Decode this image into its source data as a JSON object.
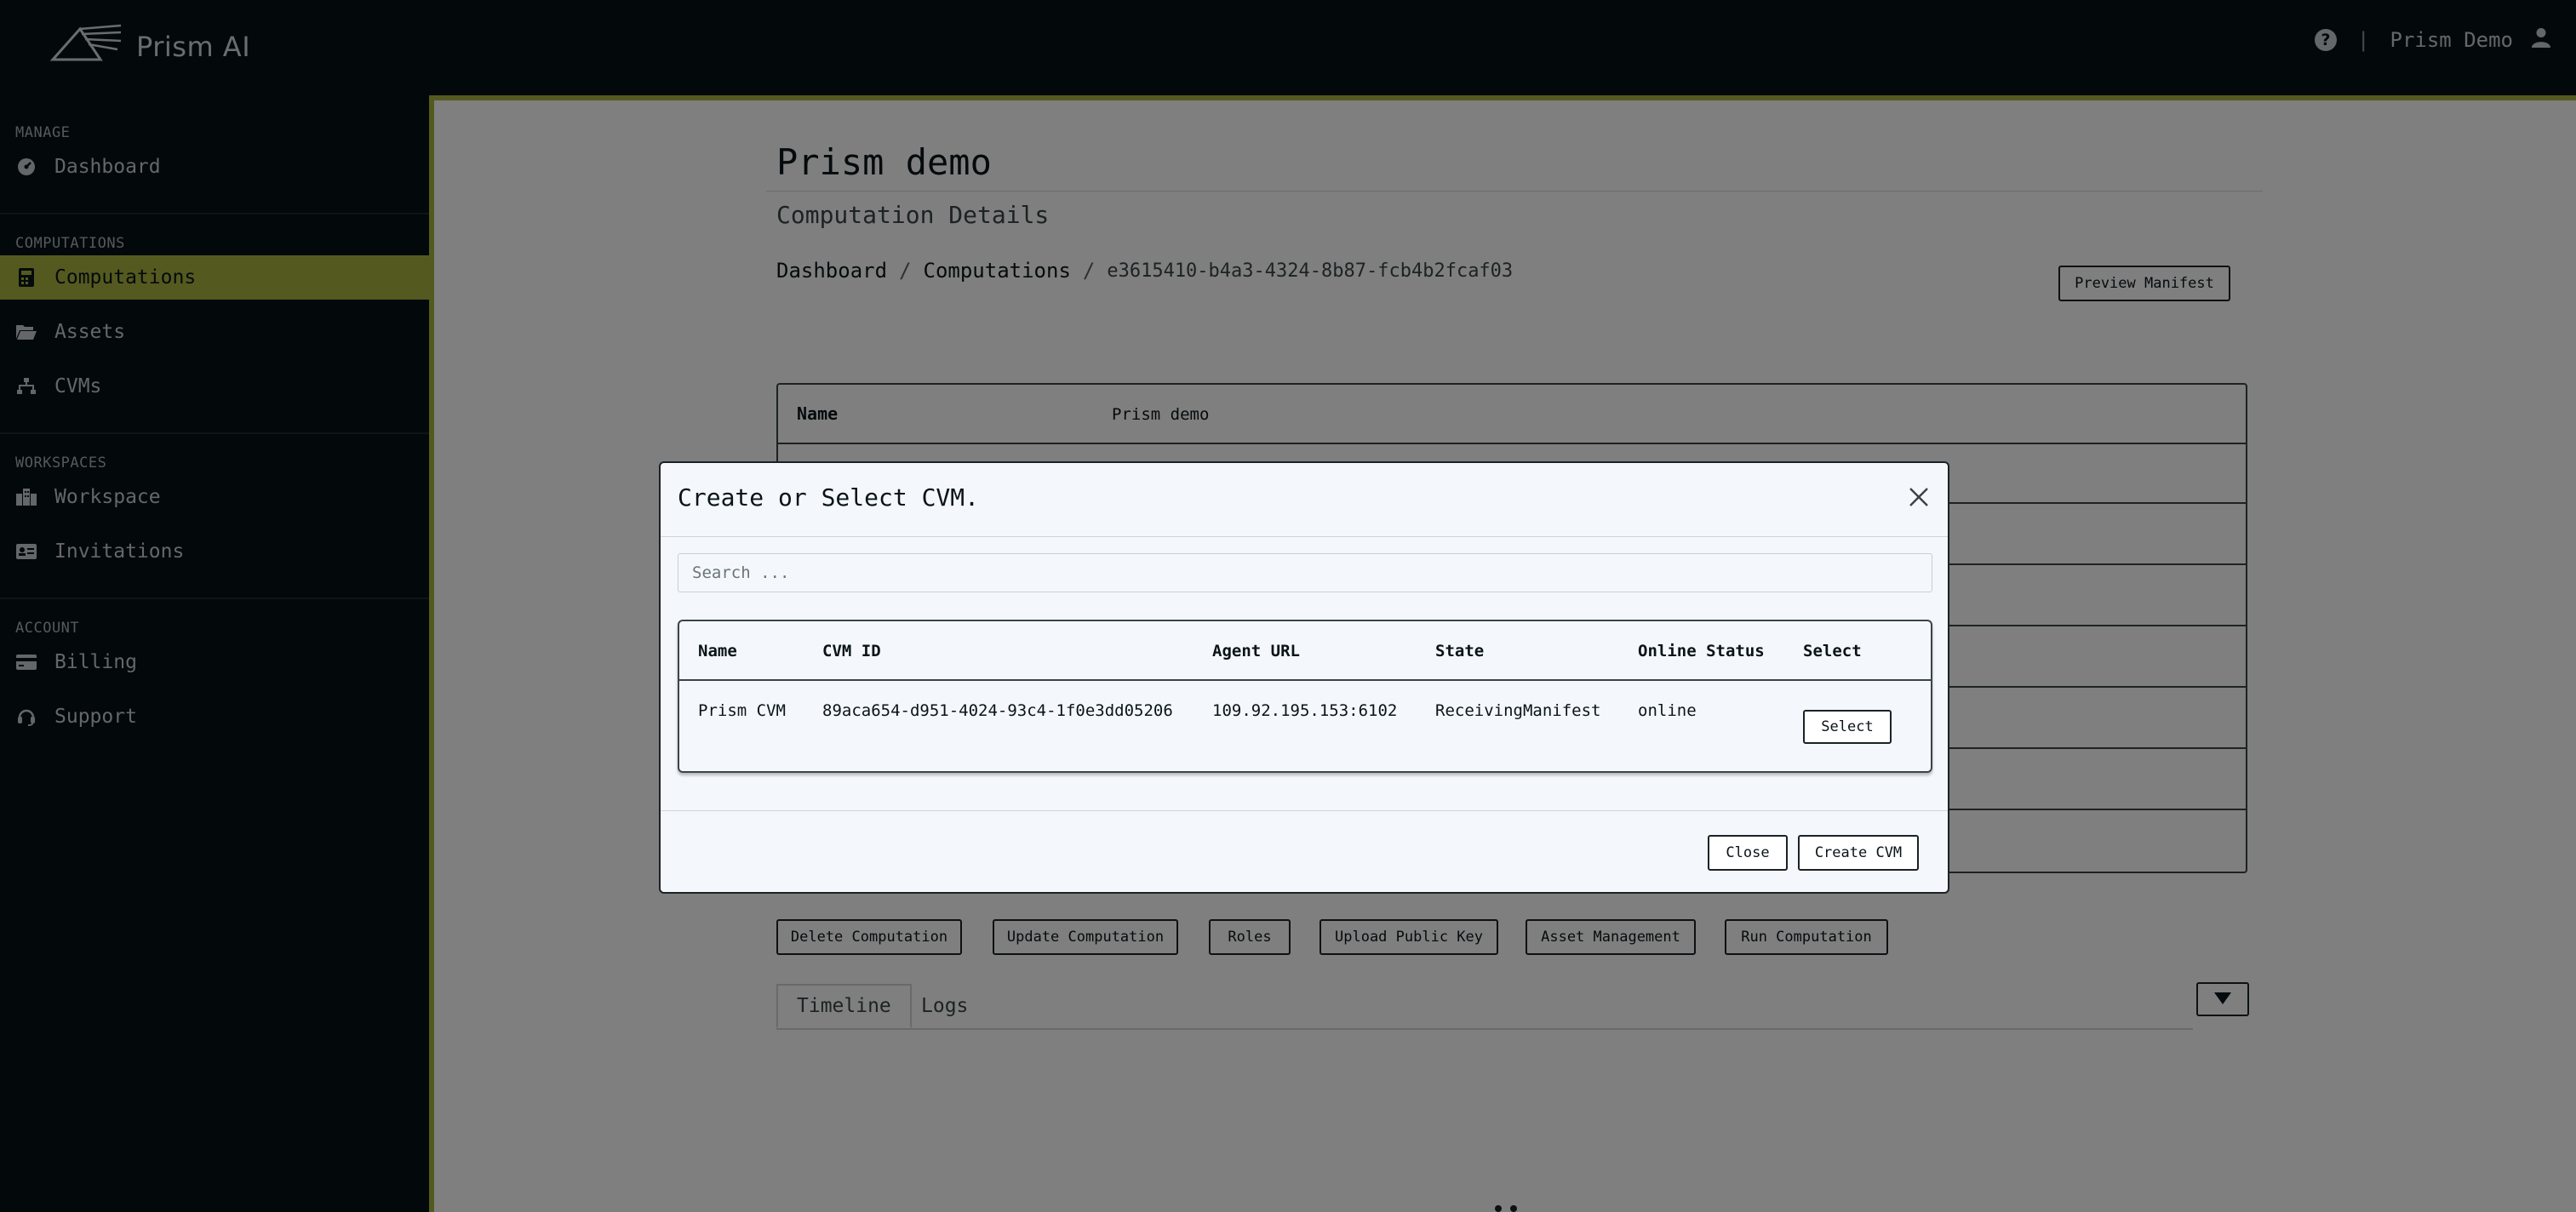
{
  "app": {
    "brand": "Prism AI",
    "user_name": "Prism Demo",
    "help_glyph": "?",
    "separator": "|"
  },
  "sidebar": {
    "sections": [
      {
        "label": "MANAGE",
        "items": [
          {
            "label": "Dashboard",
            "icon": "gauge-icon"
          }
        ]
      },
      {
        "label": "COMPUTATIONS",
        "items": [
          {
            "label": "Computations",
            "icon": "calculator-icon",
            "active": true
          },
          {
            "label": "Assets",
            "icon": "folder-open-icon"
          },
          {
            "label": "CVMs",
            "icon": "sitemap-icon"
          }
        ]
      },
      {
        "label": "WORKSPACES",
        "items": [
          {
            "label": "Workspace",
            "icon": "building-icon"
          },
          {
            "label": "Invitations",
            "icon": "id-card-icon"
          }
        ]
      },
      {
        "label": "ACCOUNT",
        "items": [
          {
            "label": "Billing",
            "icon": "credit-card-icon"
          },
          {
            "label": "Support",
            "icon": "headset-icon"
          }
        ]
      }
    ]
  },
  "main": {
    "title": "Prism demo",
    "subtitle": "Computation Details",
    "breadcrumb": {
      "dashboard": "Dashboard",
      "computations": "Computations",
      "current": "e3615410-b4a3-4324-8b87-fcb4b2fcaf03",
      "separator": "/"
    },
    "preview_manifest_label": "Preview Manifest",
    "details": {
      "name_label": "Name",
      "name_value": "Prism demo"
    },
    "actions": {
      "delete": "Delete Computation",
      "update": "Update Computation",
      "roles": "Roles",
      "upload_key": "Upload Public Key",
      "asset_management": "Asset Management",
      "run": "Run Computation"
    },
    "tabs": {
      "timeline": "Timeline",
      "logs": "Logs"
    }
  },
  "modal": {
    "title": "Create or Select CVM.",
    "search_placeholder": "Search ...",
    "table": {
      "headers": {
        "name": "Name",
        "cvm_id": "CVM ID",
        "agent_url": "Agent URL",
        "state": "State",
        "online_status": "Online Status",
        "select": "Select"
      },
      "rows": [
        {
          "name": "Prism CVM",
          "cvm_id": "89aca654-d951-4024-93c4-1f0e3dd05206",
          "agent_url": "109.92.195.153:6102",
          "state": "ReceivingManifest",
          "online_status": "online",
          "select_label": "Select"
        }
      ]
    },
    "close_label": "Close",
    "create_label": "Create CVM"
  },
  "colors": {
    "accent": "#a9b43f",
    "sidebar_bg": "#061114",
    "modal_bg": "#f4f8fc"
  }
}
